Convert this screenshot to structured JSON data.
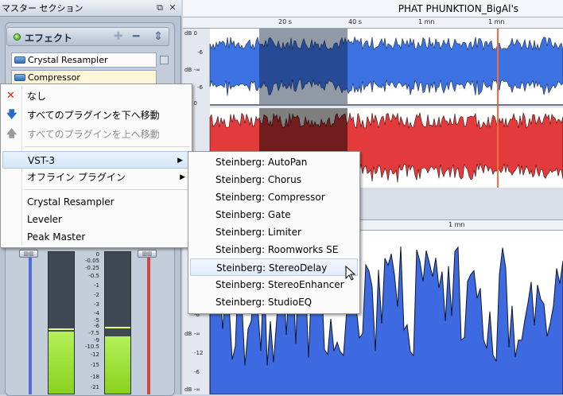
{
  "master": {
    "title": "マスター セクション",
    "effects_label": "エフェクト",
    "slots": [
      "Crystal Resampler",
      "Compressor"
    ],
    "meter_scale": [
      "0",
      "-0.05",
      "-0.25",
      "-0.5",
      "-1",
      "-2",
      "-3",
      "-4",
      "-5",
      "-6",
      "-7.5",
      "-9",
      "-10.5",
      "-12",
      "-15",
      "-18",
      "-21"
    ]
  },
  "wave": {
    "title": "PHAT PHUNKTION_BigAl's",
    "ruler_top": [
      "20 s",
      "40 s",
      "1 mn",
      "1 mn"
    ],
    "ruler_bottom": [
      "1 mn"
    ],
    "db_labels": [
      "dB 0",
      "-6",
      "dB -∞",
      "-6",
      "dB 0",
      "-6",
      "dB -∞",
      "-12",
      "-6",
      "-12",
      "dB -∞"
    ],
    "colors": {
      "top_channel": "#3d72e2",
      "bottom_channel": "#e33b3b",
      "lower_wave": "#3d6ae0"
    }
  },
  "menu1": {
    "items": [
      {
        "label": "なし",
        "icon": "close-icon",
        "disabled": false
      },
      {
        "label": "すべてのプラグインを下へ移動",
        "icon": "arrow-down-icon",
        "disabled": false
      },
      {
        "label": "すべてのプラグインを上へ移動",
        "icon": "arrow-up-icon",
        "disabled": true
      },
      {
        "label": "VST-3",
        "submenu": true,
        "highlighted": true
      },
      {
        "label": "オフライン プラグイン",
        "submenu": true
      },
      {
        "label": "Crystal Resampler"
      },
      {
        "label": "Leveler"
      },
      {
        "label": "Peak Master"
      }
    ]
  },
  "menu2": {
    "items": [
      "Steinberg: AutoPan",
      "Steinberg: Chorus",
      "Steinberg: Compressor",
      "Steinberg: Gate",
      "Steinberg: Limiter",
      "Steinberg: Roomworks SE",
      "Steinberg: StereoDelay",
      "Steinberg: StereoEnhancer",
      "Steinberg: StudioEQ"
    ],
    "highlighted_index": 6
  }
}
